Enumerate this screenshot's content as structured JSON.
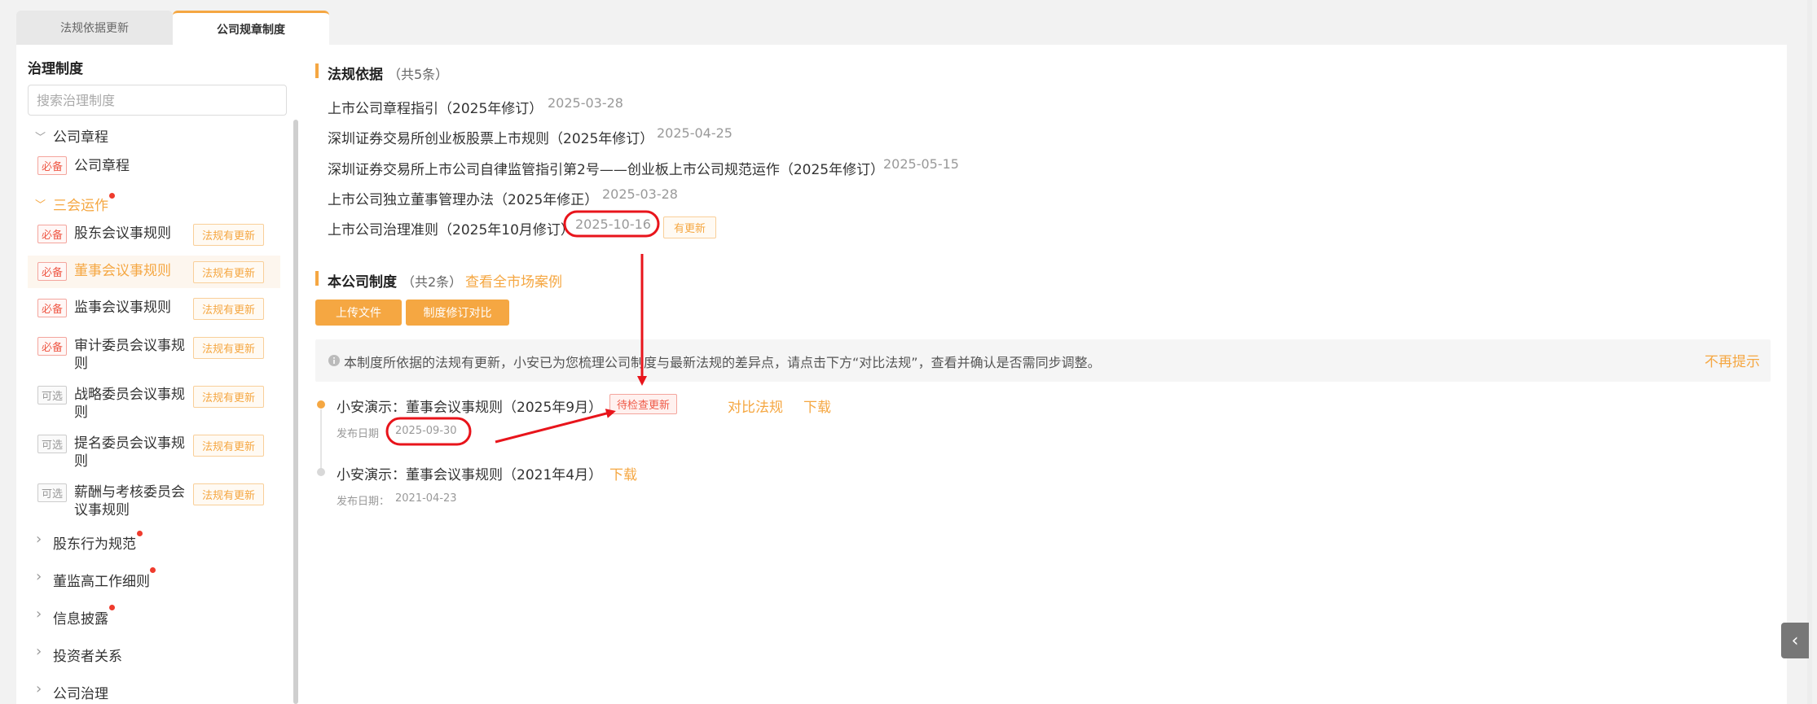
{
  "tabs": [
    {
      "label": "法规依据更新"
    },
    {
      "label": "公司规章制度"
    }
  ],
  "sidebar": {
    "heading": "治理制度",
    "search_placeholder": "搜索治理制度",
    "groups": [
      {
        "label": "公司章程",
        "expanded": true,
        "items": [
          {
            "badge": "必备",
            "label": "公司章程"
          }
        ]
      },
      {
        "label": "三会运作",
        "expanded": true,
        "active": true,
        "items": [
          {
            "badge": "必备",
            "label": "股东会议事规则",
            "tag": "法规有更新"
          },
          {
            "badge": "必备",
            "label": "董事会议事规则",
            "tag": "法规有更新",
            "selected": true
          },
          {
            "badge": "必备",
            "label": "监事会议事规则",
            "tag": "法规有更新"
          },
          {
            "badge": "必备",
            "label_line1": "审计委员会议事规",
            "label_line2": "则",
            "tag": "法规有更新"
          },
          {
            "badge": "可选",
            "label_line1": "战略委员会议事规",
            "label_line2": "则",
            "tag": "法规有更新"
          },
          {
            "badge": "可选",
            "label_line1": "提名委员会议事规",
            "label_line2": "则",
            "tag": "法规有更新"
          },
          {
            "badge": "可选",
            "label_line1": "薪酬与考核委员会",
            "label_line2": "议事规则",
            "tag": "法规有更新"
          }
        ]
      },
      {
        "label": "股东行为规范",
        "expanded": false
      },
      {
        "label": "董监高工作细则",
        "expanded": false
      },
      {
        "label": "信息披露",
        "expanded": false
      },
      {
        "label": "投资者关系",
        "expanded": false
      },
      {
        "label": "公司治理",
        "expanded": false
      }
    ]
  },
  "regulations": {
    "title": "法规依据",
    "count": "（共5条）",
    "items": [
      {
        "name": "上市公司章程指引（2025年修订）",
        "date": "2025-03-28"
      },
      {
        "name": "深圳证券交易所创业板股票上市规则（2025年修订）",
        "date": "2025-04-25"
      },
      {
        "name": "深圳证券交易所上市公司自律监管指引第2号——创业板上市公司规范运作（2025年修订）",
        "date": "2025-05-15"
      },
      {
        "name": "上市公司独立董事管理办法（2025年修正）",
        "date": "2025-03-28"
      },
      {
        "name": "上市公司治理准则（2025年10月修订）",
        "date": "2025-10-16",
        "tag": "有更新"
      }
    ]
  },
  "company": {
    "title": "本公司制度",
    "count": "（共2条）",
    "case_link": "查看全市场案例",
    "upload_btn": "上传文件",
    "compare_btn": "制度修订对比",
    "notice_icon": "info-icon",
    "notice": "本制度所依据的法规有更新，小安已为您梳理公司制度与最新法规的差异点，请点击下方“对比法规”，查看并确认是否需同步调整。",
    "dismiss": "不再提示",
    "docs": [
      {
        "name": "小安演示：董事会议事规则（2025年9月）",
        "tag": "待检查更新",
        "date_label": "发布日期",
        "date": "2025-09-30",
        "compare": "对比法规",
        "download": "下载"
      },
      {
        "name": "小安演示：董事会议事规则（2021年4月）",
        "date_label": "发布日期：",
        "date": "2021-04-23",
        "download": "下载"
      }
    ]
  },
  "colors": {
    "accent": "#f5a742",
    "highlight_red": "#e8141b",
    "required_badge": "#ef5a48"
  }
}
